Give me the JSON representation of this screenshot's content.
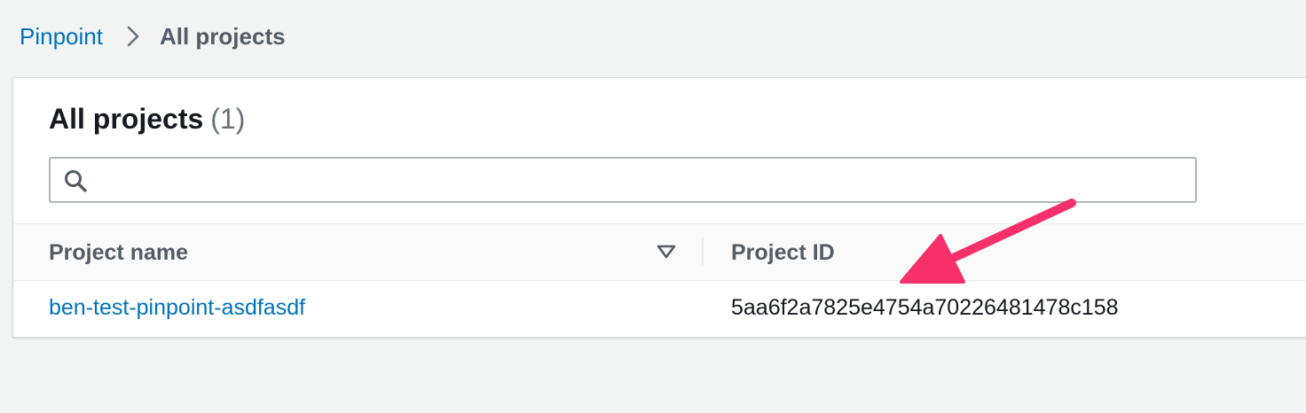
{
  "breadcrumb": {
    "parent": "Pinpoint",
    "current": "All projects"
  },
  "panel": {
    "title": "All projects",
    "count": "(1)"
  },
  "search": {
    "value": "",
    "placeholder": ""
  },
  "table": {
    "columns": {
      "name": "Project name",
      "id": "Project ID"
    },
    "rows": [
      {
        "name": "ben-test-pinpoint-asdfasdf",
        "id": "5aa6f2a7825e4754a70226481478c158"
      }
    ]
  },
  "colors": {
    "link": "#0073bb",
    "annotation_arrow": "#f7306a"
  },
  "icons": {
    "breadcrumb_separator": "chevron-right-icon",
    "search": "search-icon",
    "sort": "sort-down-icon",
    "annotation": "arrow-annotation-icon"
  }
}
